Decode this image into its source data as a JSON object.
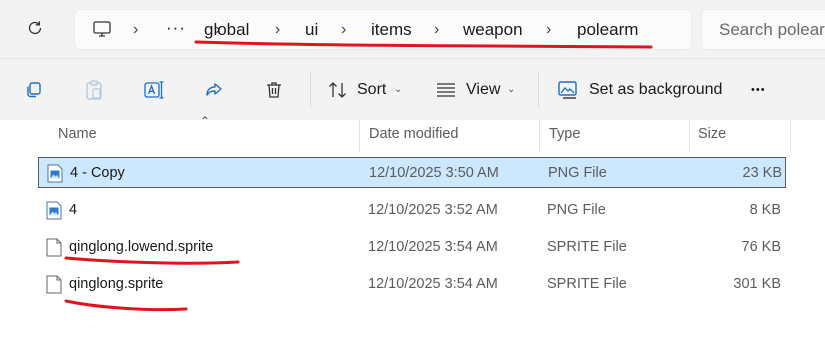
{
  "addressbar": {
    "crumbs": [
      "global",
      "ui",
      "items",
      "weapon",
      "polearm"
    ],
    "overflow": "···",
    "separator": "›"
  },
  "search": {
    "placeholder": "Search polear"
  },
  "toolbar": {
    "sort_label": "Sort",
    "view_label": "View",
    "background_label": "Set as background",
    "more": "•••",
    "chevron": "⌄"
  },
  "columns": {
    "name": "Name",
    "date": "Date modified",
    "type": "Type",
    "size": "Size",
    "sort_caret": "⌃"
  },
  "files": [
    {
      "name": "4 - Copy",
      "date": "12/10/2025 3:50 AM",
      "type": "PNG File",
      "size": "23 KB",
      "icon": "image-file-icon",
      "selected": true
    },
    {
      "name": "4",
      "date": "12/10/2025 3:52 AM",
      "type": "PNG File",
      "size": "8 KB",
      "icon": "image-file-icon",
      "selected": false
    },
    {
      "name": "qinglong.lowend.sprite",
      "date": "12/10/2025 3:54 AM",
      "type": "SPRITE File",
      "size": "76 KB",
      "icon": "generic-file-icon",
      "selected": false
    },
    {
      "name": "qinglong.sprite",
      "date": "12/10/2025 3:54 AM",
      "type": "SPRITE File",
      "size": "301 KB",
      "icon": "generic-file-icon",
      "selected": false
    }
  ],
  "colors": {
    "annotation": "#e0141a",
    "selection": "#cce8ff",
    "accent": "#0067c0"
  }
}
